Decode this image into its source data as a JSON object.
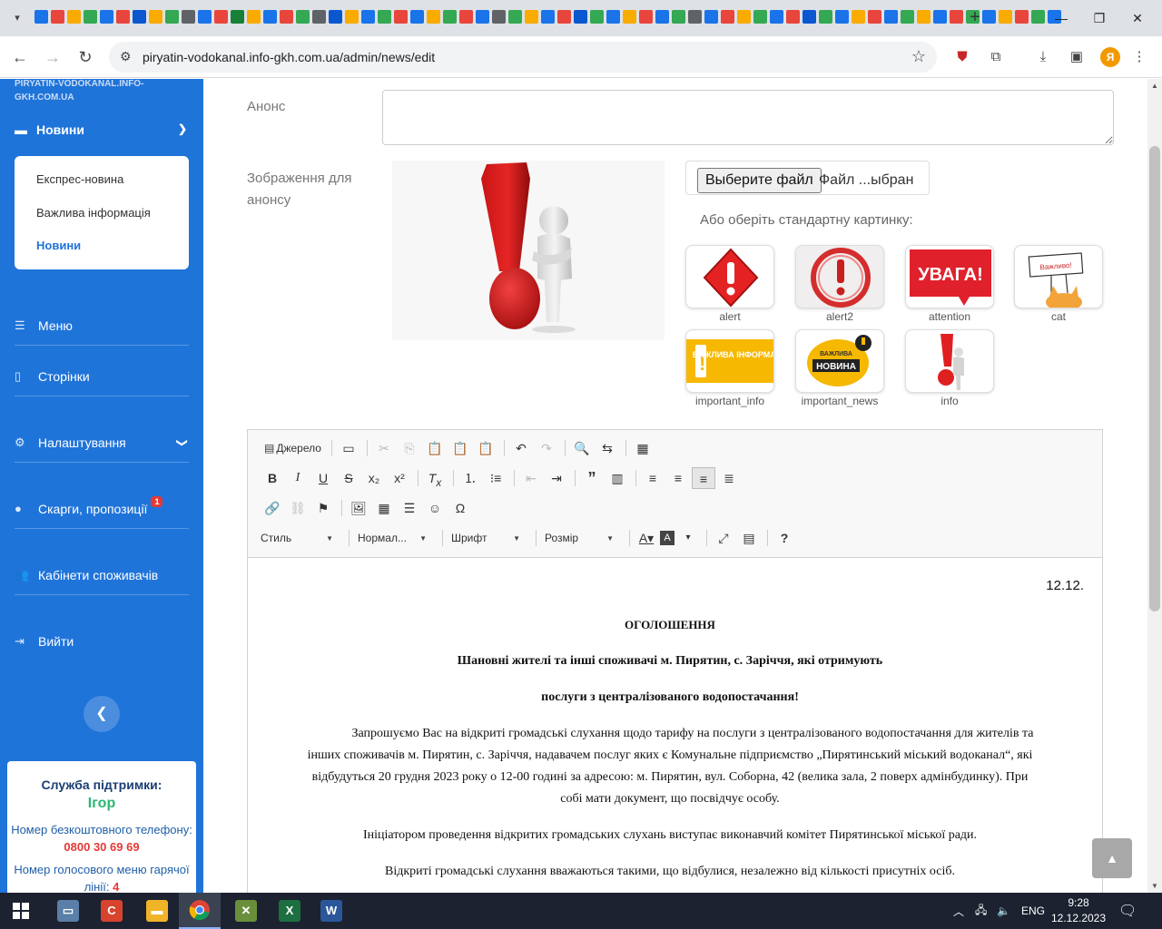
{
  "browser": {
    "url": "piryatin-vodokanal.info-gkh.com.ua/admin/news/edit",
    "profile_initial": "Я",
    "favicon_colors": [
      "#1a73e8",
      "#e8453c",
      "#f9ab00",
      "#34a853",
      "#1a73e8",
      "#e8453c",
      "#0b57d0",
      "#f9ab00",
      "#34a853",
      "#5f6368",
      "#1a73e8",
      "#e8453c",
      "#188038",
      "#f9ab00",
      "#1a73e8",
      "#e8453c",
      "#34a853",
      "#5f6368",
      "#0b57d0",
      "#f9ab00",
      "#1a73e8",
      "#34a853",
      "#e8453c",
      "#1a73e8",
      "#f9ab00",
      "#34a853",
      "#e8453c",
      "#1a73e8",
      "#5f6368",
      "#34a853",
      "#f9ab00",
      "#1a73e8",
      "#e8453c",
      "#0b57d0",
      "#34a853",
      "#1a73e8",
      "#f9ab00",
      "#e8453c",
      "#1a73e8",
      "#34a853",
      "#5f6368",
      "#1a73e8",
      "#e8453c",
      "#f9ab00",
      "#34a853",
      "#1a73e8",
      "#e8453c",
      "#0b57d0",
      "#34a853",
      "#1a73e8",
      "#f9ab00",
      "#e8453c",
      "#1a73e8",
      "#34a853",
      "#f9ab00",
      "#1a73e8",
      "#e8453c",
      "#34a853",
      "#1a73e8",
      "#f9ab00",
      "#e8453c",
      "#34a853",
      "#1a73e8"
    ]
  },
  "sidebar": {
    "site_title": "PIRYATIN-VODOKANAL.INFO-GKH.COM.UA",
    "news_menu_label": "Новини",
    "submenu": [
      "Експрес-новина",
      "Важлива інформація",
      "Новини"
    ],
    "items": [
      {
        "label": "Меню",
        "icon": "list-icon"
      },
      {
        "label": "Сторінки",
        "icon": "file-icon"
      },
      {
        "label": "Налаштування",
        "icon": "gear-icon"
      },
      {
        "label": "Скарги, пропозиції",
        "icon": "alert-circle-icon",
        "badge": "1"
      },
      {
        "label": "Кабінети споживачів",
        "icon": "users-icon"
      },
      {
        "label": "Вийти",
        "icon": "logout-icon"
      }
    ],
    "support": {
      "heading": "Служба підтримки:",
      "name": "Ігор",
      "free_phone_label": "Номер безкоштовного телефону:",
      "free_phone": "0800 30 69 69",
      "voice_menu_label": "Номер голосового меню гарячої лінії:",
      "voice_menu_value": "4"
    }
  },
  "form": {
    "anons_label": "Анонс",
    "image_label": "Зображення для анонсу",
    "file_button": "Выберите файл",
    "file_status": "Файл ...ыбран",
    "or_text": "Або оберіть стандартну картинку:",
    "standard_images": [
      "alert",
      "alert2",
      "attention",
      "cat",
      "important_info",
      "important_news",
      "info"
    ],
    "thumb_texts": {
      "attention": "УВАГА!",
      "cat": "Важливо!",
      "important_info": "ВАЖЛИВА ІНФОРМАЦІЯ!",
      "important_news_top": "ВАЖЛИВА",
      "important_news_main": "НОВИНА"
    }
  },
  "editor": {
    "source_label": "Джерело",
    "combos": [
      "Стиль",
      "Нормал...",
      "Шрифт",
      "Розмір"
    ],
    "content": {
      "date": "12.12.",
      "heading": "ОГОЛОШЕННЯ",
      "subheading_1": "Шановні жителі та інші споживачі м. Пирятин, с. Заріччя, які отримують",
      "subheading_2": "послуги з централізованого водопостачання!",
      "para_1": "Запрошуємо Вас на відкриті громадські слухання щодо тарифу на послуги з централізованого водопостачання для жителів та інших споживачів м. Пирятин, с. Заріччя, надавачем послуг яких є Комунальне підприємство „Пирятинський міський водоканал“, які відбудуться 20 грудня 2023 року о  12-00 годині за адресою: м. Пирятин, вул. Соборна, 42  (велика зала, 2 поверх адмінбудинку). При собі мати документ, що посвідчує особу.",
      "para_2": "Ініціатором проведення відкритих громадських слухань виступає виконавчий комітет Пирятинської міської ради.",
      "para_3": "Відкриті громадські слухання вважаються такими, що відбулися, незалежно від кількості присутніх осіб."
    }
  },
  "taskbar": {
    "lang": "ENG",
    "time": "9:28",
    "date": "12.12.2023"
  }
}
